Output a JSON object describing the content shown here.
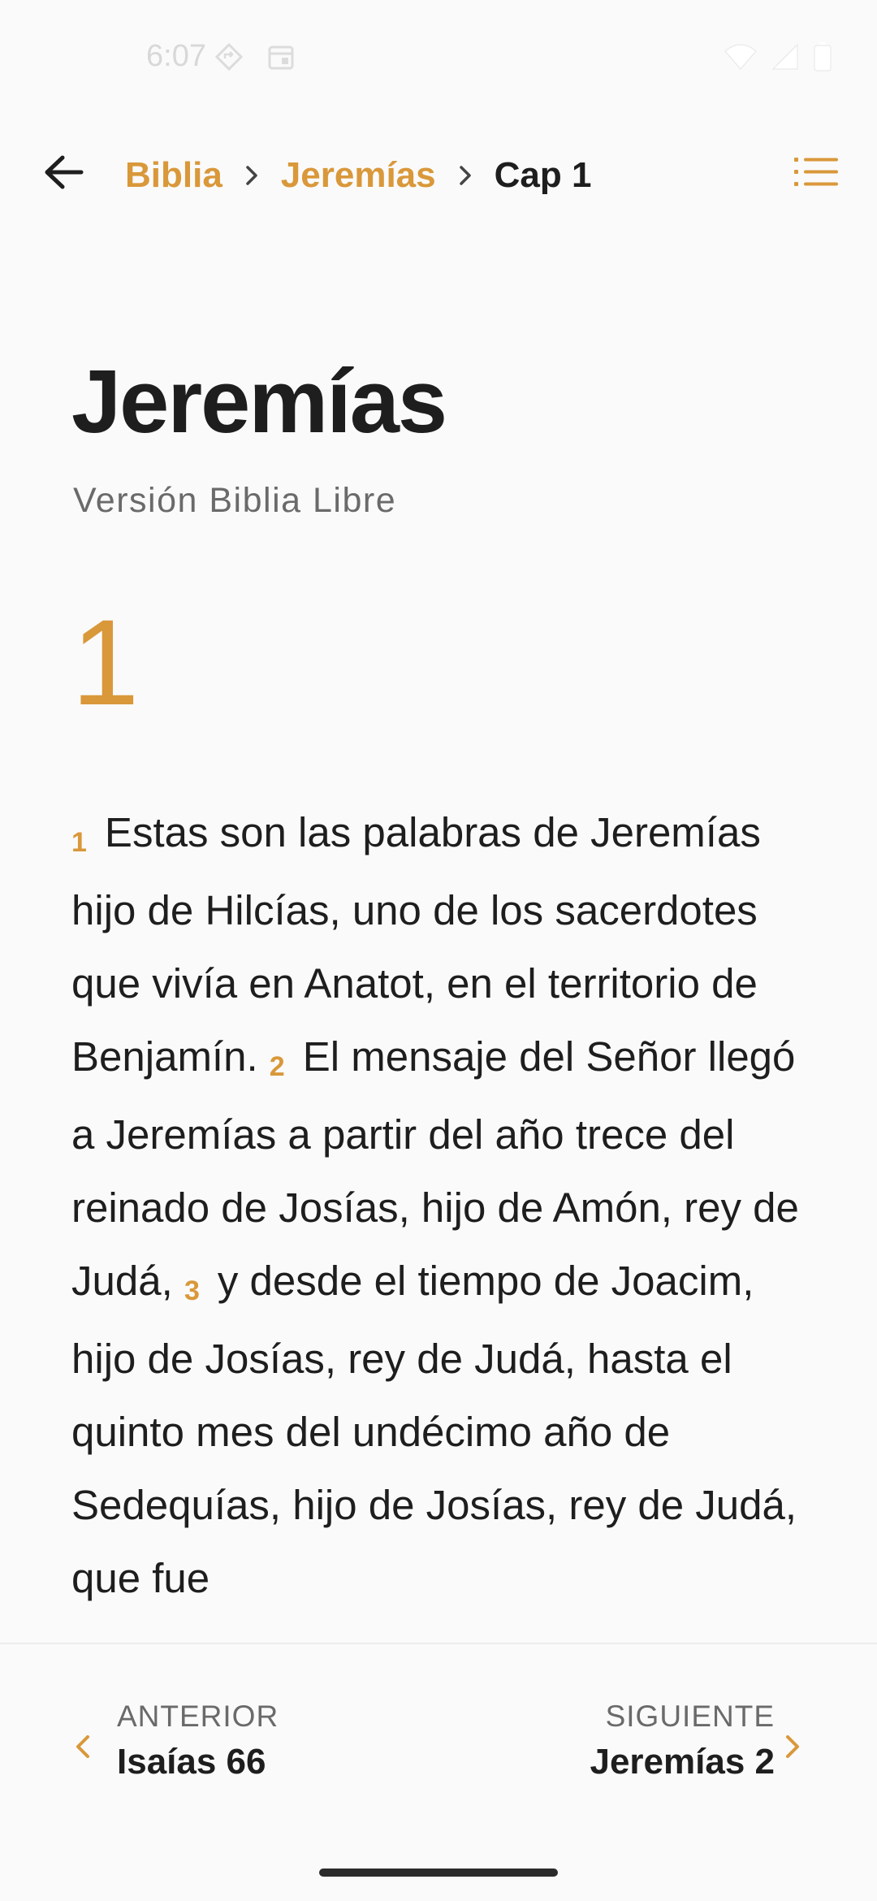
{
  "status_bar": {
    "time": "6:07",
    "icons": [
      "navigation-icon",
      "calendar-icon",
      "wifi-icon",
      "signal-icon",
      "battery-icon"
    ]
  },
  "header": {
    "breadcrumb": [
      {
        "label": "Biblia"
      },
      {
        "label": "Jeremías"
      },
      {
        "label": "Cap 1"
      }
    ],
    "icons": {
      "back": "arrow-back-icon",
      "toc": "list-icon",
      "separator": "chevron-right-icon"
    }
  },
  "book": {
    "title": "Jeremías",
    "version": "Versión Biblia Libre"
  },
  "chapter": {
    "number": "1",
    "verses": [
      {
        "num": "1",
        "text": "Estas son las palabras de Jeremías hijo de Hilcías, uno de los sacerdotes que vivía en Anatot, en el territorio de Benjamín."
      },
      {
        "num": "2",
        "text": "El mensaje del Señor llegó a Jeremías a partir del año trece del reinado de Josías, hijo de Amón, rey de Judá,"
      },
      {
        "num": "3",
        "text": "y desde el tiempo de Joacim, hijo de Josías, rey de Judá, hasta el quinto mes del undécimo año de Sedequías, hijo de Josías, rey de Judá, que fue"
      }
    ]
  },
  "navigation": {
    "previous": {
      "kicker": "ANTERIOR",
      "target": "Isaías 66"
    },
    "next": {
      "kicker": "SIGUIENTE",
      "target": "Jeremías 2"
    }
  },
  "colors": {
    "accent": "#d9983a",
    "text": "#1e1e1e",
    "muted": "#6a6a6a",
    "background": "#fafafa"
  }
}
